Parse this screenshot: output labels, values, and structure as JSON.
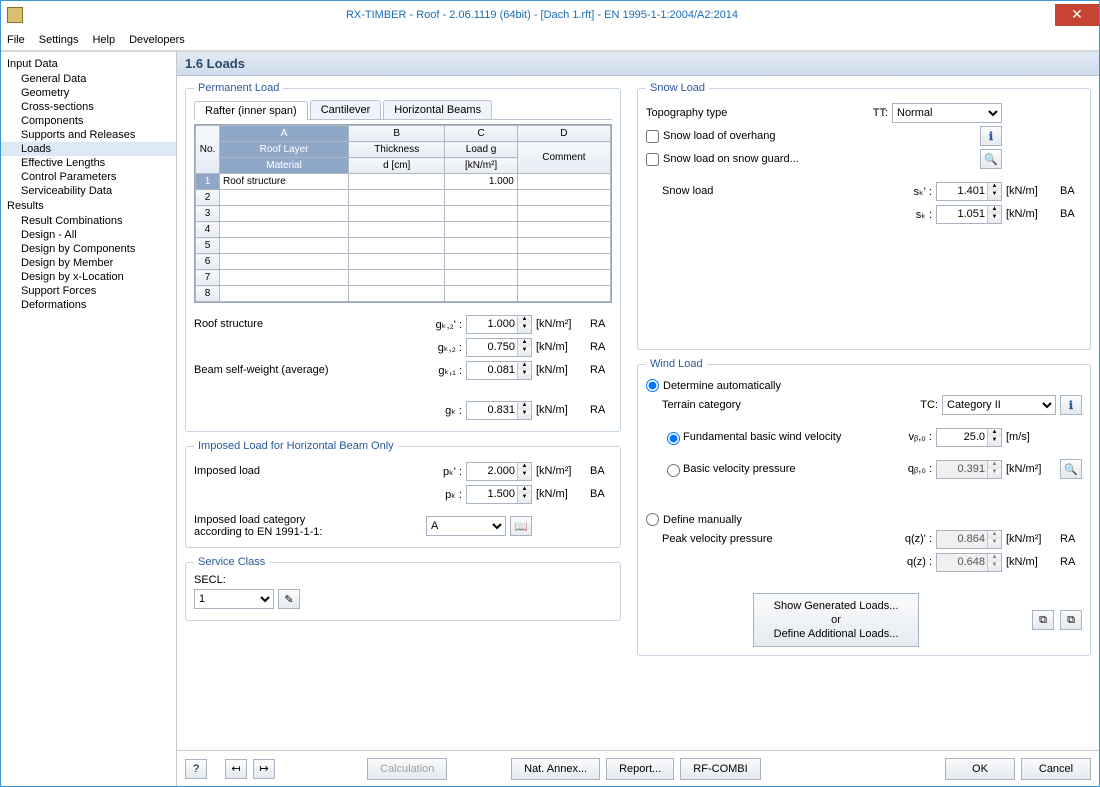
{
  "title": "RX-TIMBER - Roof - 2.06.1119 (64bit) - [Dach 1.rft] - EN 1995-1-1:2004/A2:2014",
  "menu": [
    "File",
    "Settings",
    "Help",
    "Developers"
  ],
  "tree": {
    "g1": "Input Data",
    "g1items": [
      "General Data",
      "Geometry",
      "Cross-sections",
      "Components",
      "Supports and Releases",
      "Loads",
      "Effective Lengths",
      "Control Parameters",
      "Serviceability Data"
    ],
    "g2": "Results",
    "g2items": [
      "Result Combinations",
      "Design - All",
      "Design by Components",
      "Design by Member",
      "Design by x-Location",
      "Support Forces",
      "Deformations"
    ]
  },
  "mainTitle": "1.6 Loads",
  "perm": {
    "legend": "Permanent Load",
    "tabs": [
      "Rafter (inner span)",
      "Cantilever",
      "Horizontal Beams"
    ],
    "colHdr": {
      "no": "No.",
      "A": "A",
      "B": "B",
      "C": "C",
      "D": "D"
    },
    "colSub": {
      "A1": "Roof Layer",
      "A2": "Material",
      "B1": "Thickness",
      "B2": "d [cm]",
      "C1": "Load g",
      "C2": "[kN/m²]",
      "D": "Comment"
    },
    "row1": {
      "A": "Roof structure",
      "C": "1.000"
    },
    "rs": {
      "lbl": "Roof structure",
      "s1": "gₖ,₂' :",
      "v1": "1.000",
      "u1": "[kN/m²]",
      "t1": "RA",
      "s2": "gₖ,₂ :",
      "v2": "0.750",
      "u2": "[kN/m]",
      "t2": "RA"
    },
    "bsw": {
      "lbl": "Beam self-weight (average)",
      "s": "gₖ,₁ :",
      "v": "0.081",
      "u": "[kN/m]",
      "t": "RA"
    },
    "gk": {
      "s": "gₖ :",
      "v": "0.831",
      "u": "[kN/m]",
      "t": "RA"
    }
  },
  "imp": {
    "legend": "Imposed Load for Horizontal Beam Only",
    "lbl": "Imposed load",
    "s1": "pₖ' :",
    "v1": "2.000",
    "u1": "[kN/m²]",
    "t1": "BA",
    "s2": "pₖ :",
    "v2": "1.500",
    "u2": "[kN/m]",
    "t2": "BA",
    "cat1": "Imposed load category",
    "cat2": "according to EN 1991-1-1:",
    "catv": "A"
  },
  "svc": {
    "legend": "Service Class",
    "lbl": "SECL:",
    "v": "1"
  },
  "snow": {
    "legend": "Snow Load",
    "topo": "Topography type",
    "tts": "TT:",
    "ttv": "Normal",
    "oh": "Snow load of overhang",
    "sg": "Snow load on snow guard...",
    "sl": "Snow load",
    "s1": "sₖ' :",
    "v1": "1.401",
    "u1": "[kN/m]",
    "t1": "BA",
    "s2": "sₖ :",
    "v2": "1.051",
    "u2": "[kN/m]",
    "t2": "BA"
  },
  "wind": {
    "legend": "Wind Load",
    "da": "Determine automatically",
    "tc": "Terrain category",
    "tcs": "TC:",
    "tcv": "Category II",
    "fb": "Fundamental basic wind velocity",
    "fbs": "vᵦ,₀ :",
    "fbv": "25.0",
    "fbu": "[m/s]",
    "bv": "Basic velocity pressure",
    "bvs": "qᵦ,₀ :",
    "bvv": "0.391",
    "bvu": "[kN/m²]",
    "dm": "Define manually",
    "pv": "Peak velocity pressure",
    "pvs1": "q(z)' :",
    "pvv1": "0.864",
    "pvu1": "[kN/m²]",
    "pvt1": "RA",
    "pvs2": "q(z) :",
    "pvv2": "0.648",
    "pvu2": "[kN/m]",
    "pvt2": "RA",
    "btn1": "Show Generated Loads...",
    "btn2": "or",
    "btn3": "Define Additional Loads..."
  },
  "footer": {
    "calc": "Calculation",
    "na": "Nat. Annex...",
    "rep": "Report...",
    "rf": "RF-COMBI",
    "ok": "OK",
    "cancel": "Cancel"
  }
}
